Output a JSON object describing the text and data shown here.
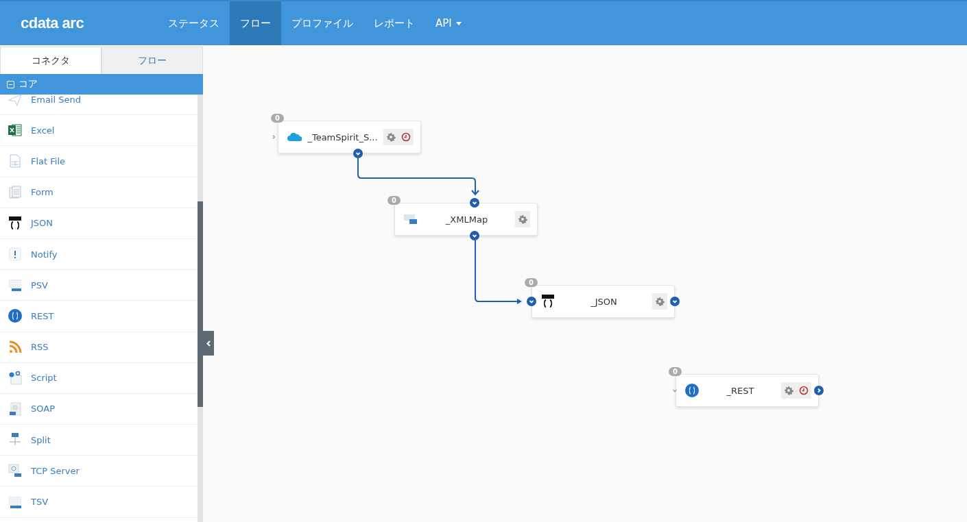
{
  "header": {
    "logo": "cdata arc",
    "nav": [
      {
        "label": "ステータス",
        "selected": false,
        "dropdown": false
      },
      {
        "label": "フロー",
        "selected": true,
        "dropdown": false
      },
      {
        "label": "プロファイル",
        "selected": false,
        "dropdown": false
      },
      {
        "label": "レポート",
        "selected": false,
        "dropdown": false
      },
      {
        "label": "API",
        "selected": false,
        "dropdown": true
      }
    ]
  },
  "sidebar": {
    "tabs": [
      {
        "label": "コネクタ",
        "selected": true
      },
      {
        "label": "フロー",
        "selected": false
      }
    ],
    "section": {
      "label": "コア",
      "expanded": true
    },
    "items": [
      {
        "label": "Email Send"
      },
      {
        "label": "Excel"
      },
      {
        "label": "Flat File"
      },
      {
        "label": "Form"
      },
      {
        "label": "JSON"
      },
      {
        "label": "Notify"
      },
      {
        "label": "PSV"
      },
      {
        "label": "REST"
      },
      {
        "label": "RSS"
      },
      {
        "label": "Script"
      },
      {
        "label": "SOAP"
      },
      {
        "label": "Split"
      },
      {
        "label": "TCP Server"
      },
      {
        "label": "TSV"
      }
    ]
  },
  "flow": {
    "nodes": [
      {
        "label": "_TeamSpirit_S...",
        "count": "0",
        "schedule": true
      },
      {
        "label": "_XMLMap",
        "count": "0",
        "schedule": false
      },
      {
        "label": "_JSON",
        "count": "0",
        "schedule": false
      },
      {
        "label": "_REST",
        "count": "0",
        "schedule": true
      }
    ]
  }
}
